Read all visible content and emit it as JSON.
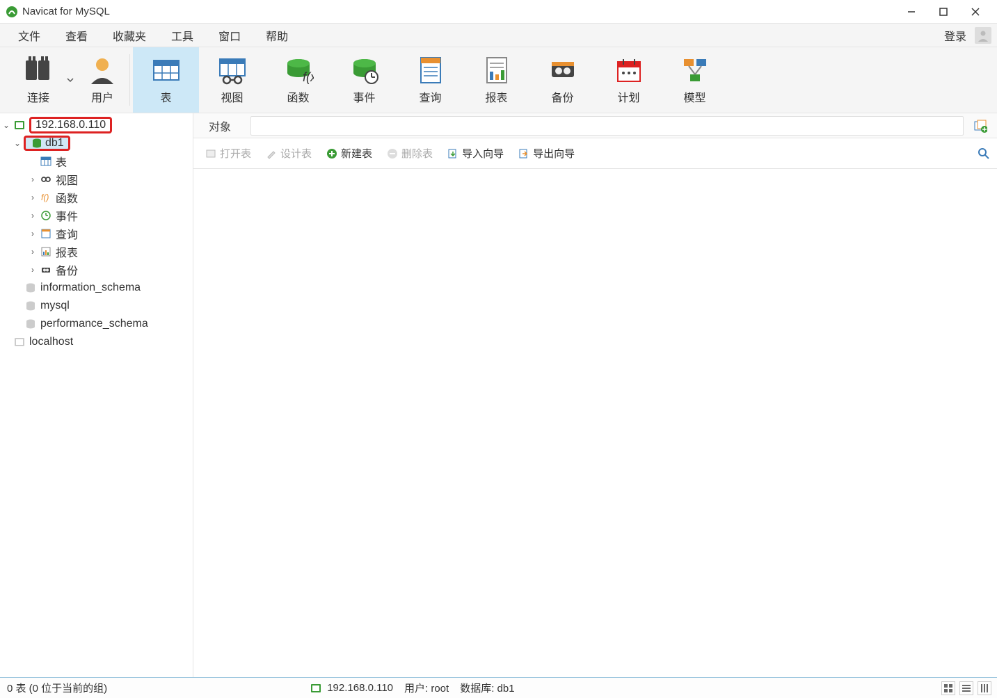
{
  "title": "Navicat for MySQL",
  "menu": {
    "file": "文件",
    "view": "查看",
    "favorites": "收藏夹",
    "tools": "工具",
    "window": "窗口",
    "help": "帮助",
    "login": "登录"
  },
  "ribbon": {
    "connect": "连接",
    "user": "用户",
    "table": "表",
    "view": "视图",
    "function": "函数",
    "event": "事件",
    "query": "查询",
    "report": "报表",
    "backup": "备份",
    "schedule": "计划",
    "model": "模型"
  },
  "tree": {
    "conn1": "192.168.0.110",
    "db1": "db1",
    "tables": "表",
    "views": "视图",
    "functions": "函数",
    "events": "事件",
    "queries": "查询",
    "reports": "报表",
    "backups": "备份",
    "info_schema": "information_schema",
    "mysql": "mysql",
    "perf_schema": "performance_schema",
    "localhost": "localhost"
  },
  "tab": {
    "objects": "对象"
  },
  "toolbar2": {
    "open": "打开表",
    "design": "设计表",
    "new": "新建表",
    "delete": "删除表",
    "import": "导入向导",
    "export": "导出向导"
  },
  "status": {
    "left": "0 表 (0 位于当前的组)",
    "conn": "192.168.0.110",
    "user_label": "用户:",
    "user_value": "root",
    "db_label": "数据库:",
    "db_value": "db1"
  }
}
